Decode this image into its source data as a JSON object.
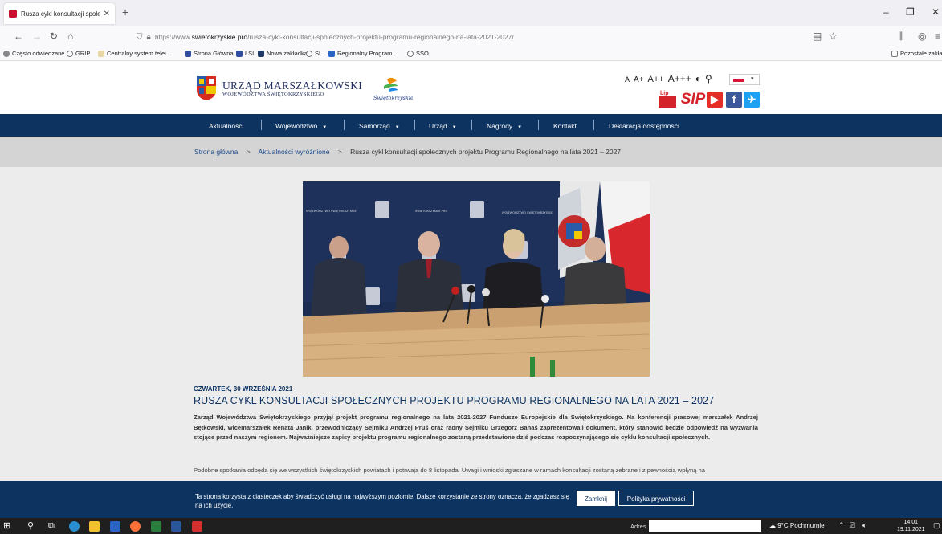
{
  "browser": {
    "tab_title": "Rusza cykl konsultacji społeczn",
    "url_prefix": "https://www.",
    "url_domain": "swietokrzyskie.pro",
    "url_path": "/rusza-cykl-konsultacji-spolecznych-projektu-programu-regionalnego-na-lata-2021-2027/",
    "bookmarks": [
      "Często odwiedzane",
      "GRIP",
      "Centralny system telei...",
      "Strona Główna",
      "LSI",
      "Nowa zakładka",
      "SL",
      "Regionalny Program ...",
      "SSO"
    ],
    "other_bookmarks": "Pozostałe zakła"
  },
  "header": {
    "logo_title": "URZĄD MARSZAŁKOWSKI",
    "logo_subtitle": "WOJEWÓDZTWA ŚWIĘTOKRZYSKIEGO",
    "brand_script": "Świętokrzyskie",
    "font_sizes": [
      "A",
      "A+",
      "A++",
      "A+++"
    ],
    "social": [
      "bip",
      "SIP",
      "YouTube",
      "Facebook",
      "Twitter"
    ]
  },
  "nav": {
    "items": [
      "Aktualności",
      "Województwo",
      "Samorząd",
      "Urząd",
      "Nagrody",
      "Kontakt",
      "Deklaracja dostępności"
    ]
  },
  "breadcrumb": {
    "home": "Strona główna",
    "section": "Aktualności wyróżnione",
    "current": "Rusza cykl konsultacji społecznych projektu Programu Regionalnego na lata 2021 – 2027"
  },
  "photo_banner_text": [
    "WOJEWÓDZTWO ŚWIĘTOKRZYSKIE",
    "ŚWIETOKRZYSKIE.PRO",
    "WOJEWÓDZTWO ŚWIĘTOKRZYSKIE"
  ],
  "article": {
    "date": "CZWARTEK, 30 WRZEŚNIA 2021",
    "title": "RUSZA CYKL KONSULTACJI SPOŁECZNYCH PROJEKTU PROGRAMU REGIONALNEGO NA LATA 2021 – 2027",
    "lead": "Zarząd Województwa Świętokrzyskiego przyjął projekt programu regionalnego na lata 2021-2027 Fundusze Europejskie dla Świętokrzyskiego. Na konferencji prasowej marszałek Andrzej Bętkowski, wicemarszałek Renata Janik, przewodniczący Sejmiku Andrzej Pruś oraz radny Sejmiku Grzegorz Banaś zaprezentowali dokument, który stanowić będzie odpowiedź na wyzwania stojące przed naszym regionem. Najważniejsze zapisy projektu programu regionalnego zostaną przedstawione dziś podczas rozpoczynającego się cyklu konsultacji społecznych.",
    "body": "Podobne spotkania odbędą się we wszystkich świętokrzyskich powiatach i potrwają do 8 listopada. Uwagi i wnioski zgłaszane w ramach konsultacji zostaną zebrane i z pewnością wpłyną na"
  },
  "cookie": {
    "message": "Ta strona korzysta z ciasteczek aby świadczyć usługi na najwyższym poziomie. Dalsze korzystanie ze strony oznacza, że zgadzasz się na ich użycie.",
    "close_label": "Zamknij",
    "privacy_label": "Polityka prywatności"
  },
  "taskbar": {
    "address_label": "Adres",
    "weather": "9°C Pochmurnie",
    "time": "14:01",
    "date": "19.11.2021"
  },
  "colors": {
    "navy": "#0d3461",
    "breadcrumb_bg": "#d4d4d4",
    "content_bg": "#ececec"
  }
}
